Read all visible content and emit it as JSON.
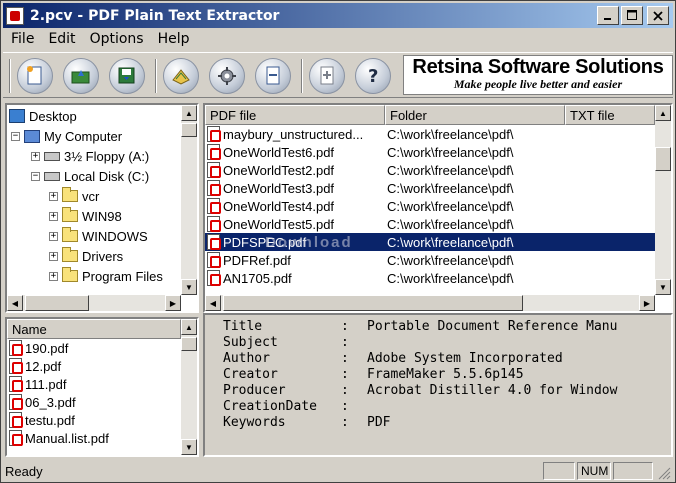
{
  "window": {
    "title": "2.pcv - PDF Plain Text Extractor"
  },
  "menu": [
    "File",
    "Edit",
    "Options",
    "Help"
  ],
  "toolbar": {
    "tools": [
      "new-icon",
      "open-icon",
      "save-icon",
      "extract-icon",
      "settings-icon",
      "remove-icon",
      "add-icon",
      "help-icon"
    ]
  },
  "brand": {
    "name": "Retsina Software Solutions",
    "tagline": "Make people live better and easier"
  },
  "tree": {
    "items": [
      {
        "label": "Desktop",
        "icon": "desktop-icon"
      },
      {
        "label": "My Computer",
        "icon": "computer-icon"
      },
      {
        "label": "3½ Floppy (A:)",
        "icon": "floppy-icon"
      },
      {
        "label": "Local Disk (C:)",
        "icon": "drive-icon"
      },
      {
        "label": "vcr",
        "icon": "folder-icon"
      },
      {
        "label": "WIN98",
        "icon": "folder-icon"
      },
      {
        "label": "WINDOWS",
        "icon": "folder-icon"
      },
      {
        "label": "Drivers",
        "icon": "folder-icon"
      },
      {
        "label": "Program Files",
        "icon": "folder-icon"
      }
    ]
  },
  "files": {
    "header": "Name",
    "items": [
      "190.pdf",
      "12.pdf",
      "111.pdf",
      "06_3.pdf",
      "testu.pdf",
      "Manual.list.pdf"
    ]
  },
  "list": {
    "columns": [
      "PDF file",
      "Folder",
      "TXT file"
    ],
    "rows": [
      {
        "file": "maybury_unstructured...",
        "folder": "C:\\work\\freelance\\pdf\\"
      },
      {
        "file": "OneWorldTest6.pdf",
        "folder": "C:\\work\\freelance\\pdf\\"
      },
      {
        "file": "OneWorldTest2.pdf",
        "folder": "C:\\work\\freelance\\pdf\\"
      },
      {
        "file": "OneWorldTest3.pdf",
        "folder": "C:\\work\\freelance\\pdf\\"
      },
      {
        "file": "OneWorldTest4.pdf",
        "folder": "C:\\work\\freelance\\pdf\\"
      },
      {
        "file": "OneWorldTest5.pdf",
        "folder": "C:\\work\\freelance\\pdf\\"
      },
      {
        "file": "PDFSPEC.pdf",
        "folder": "C:\\work\\freelance\\pdf\\"
      },
      {
        "file": "PDFRef.pdf",
        "folder": "C:\\work\\freelance\\pdf\\"
      },
      {
        "file": "AN1705.pdf",
        "folder": "C:\\work\\freelance\\pdf\\"
      }
    ]
  },
  "properties": [
    {
      "key": "Title",
      "value": "Portable Document Reference Manu"
    },
    {
      "key": "Subject",
      "value": ""
    },
    {
      "key": "Author",
      "value": "Adobe System Incorporated"
    },
    {
      "key": "Creator",
      "value": "FrameMaker 5.5.6p145"
    },
    {
      "key": "Producer",
      "value": "Acrobat Distiller 4.0 for Window"
    },
    {
      "key": "CreationDate",
      "value": ""
    },
    {
      "key": "Keywords",
      "value": "PDF"
    }
  ],
  "status": {
    "text": "Ready",
    "num": "NUM"
  },
  "watermark": "Download"
}
